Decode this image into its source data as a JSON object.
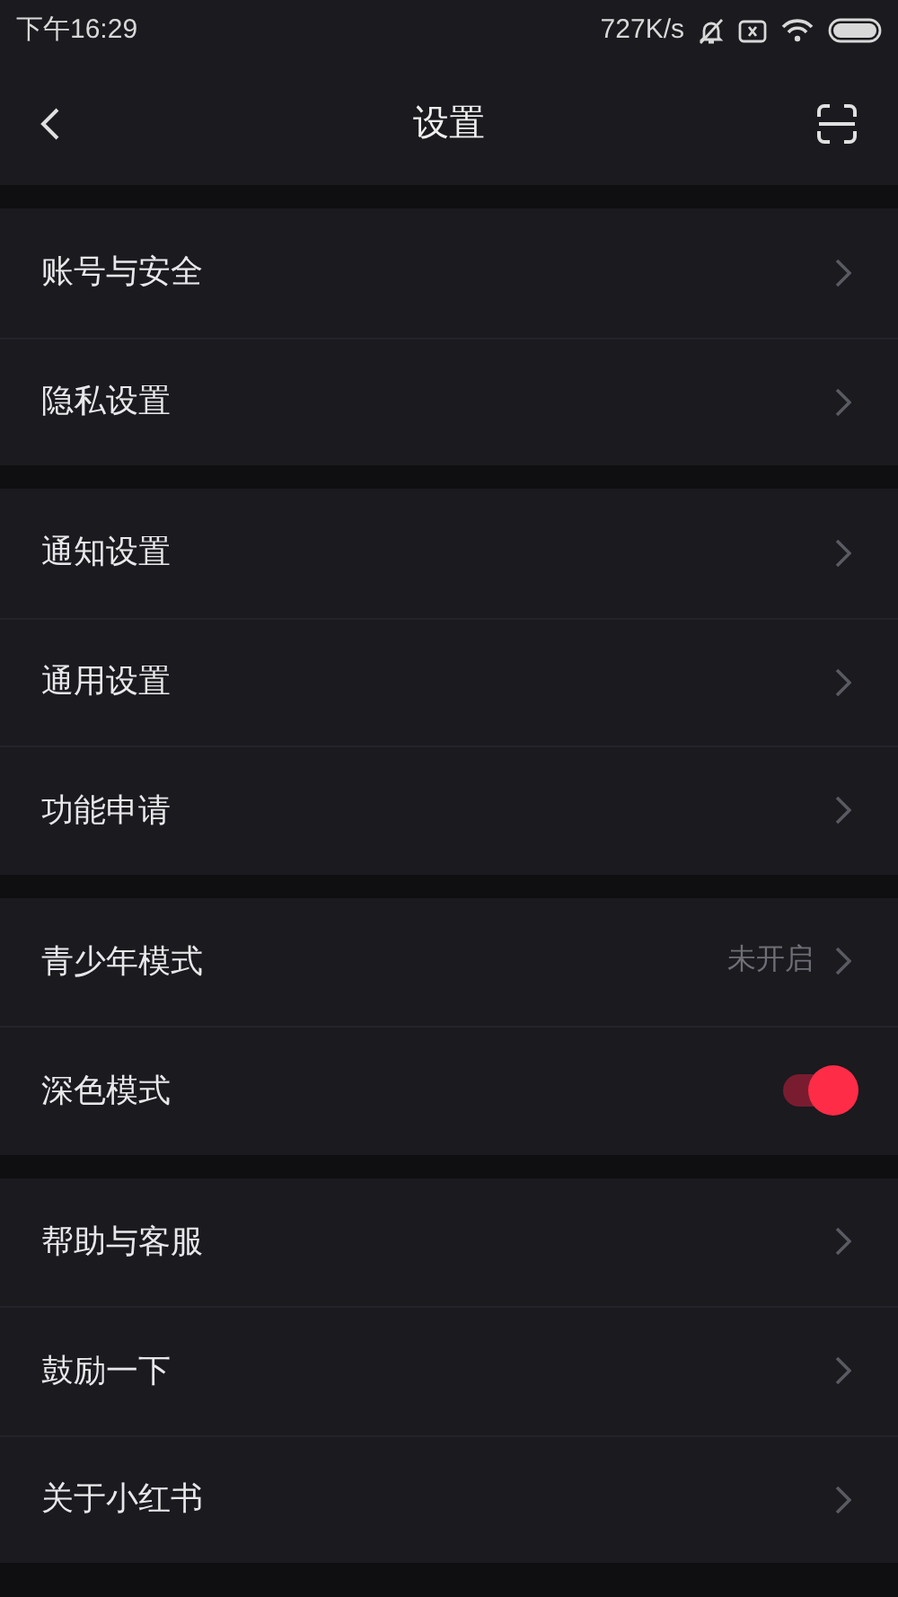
{
  "status_bar": {
    "time": "下午16:29",
    "speed": "727K/s"
  },
  "nav": {
    "title": "设置"
  },
  "groups": [
    {
      "items": [
        {
          "kind": "link",
          "label": "账号与安全"
        },
        {
          "kind": "link",
          "label": "隐私设置"
        }
      ]
    },
    {
      "items": [
        {
          "kind": "link",
          "label": "通知设置"
        },
        {
          "kind": "link",
          "label": "通用设置"
        },
        {
          "kind": "link",
          "label": "功能申请"
        }
      ]
    },
    {
      "items": [
        {
          "kind": "link",
          "label": "青少年模式",
          "value": "未开启"
        },
        {
          "kind": "toggle",
          "label": "深色模式",
          "on": true
        }
      ]
    },
    {
      "items": [
        {
          "kind": "link",
          "label": "帮助与客服"
        },
        {
          "kind": "link",
          "label": "鼓励一下"
        },
        {
          "kind": "link",
          "label": "关于小红书"
        }
      ]
    }
  ]
}
